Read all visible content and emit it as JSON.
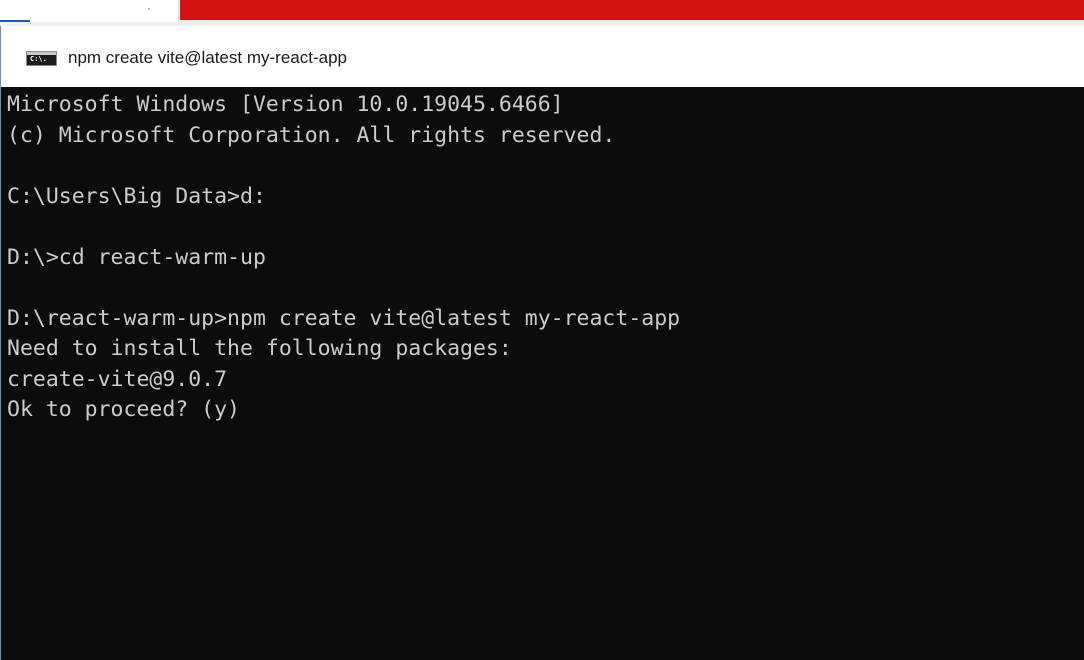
{
  "window": {
    "title": "npm create vite@latest my-react-app",
    "icon": "console-icon",
    "icon_label": "C:\\."
  },
  "colors": {
    "background_strip": "#d41111",
    "console_bg": "#0c0c0c",
    "console_text": "#cccccc"
  },
  "console": {
    "lines": [
      "Microsoft Windows [Version 10.0.19045.6466]",
      "(c) Microsoft Corporation. All rights reserved.",
      "",
      "C:\\Users\\Big Data>d:",
      "",
      "D:\\>cd react-warm-up",
      "",
      "D:\\react-warm-up>npm create vite@latest my-react-app",
      "Need to install the following packages:",
      "create-vite@9.0.7",
      "Ok to proceed? (y)"
    ]
  }
}
